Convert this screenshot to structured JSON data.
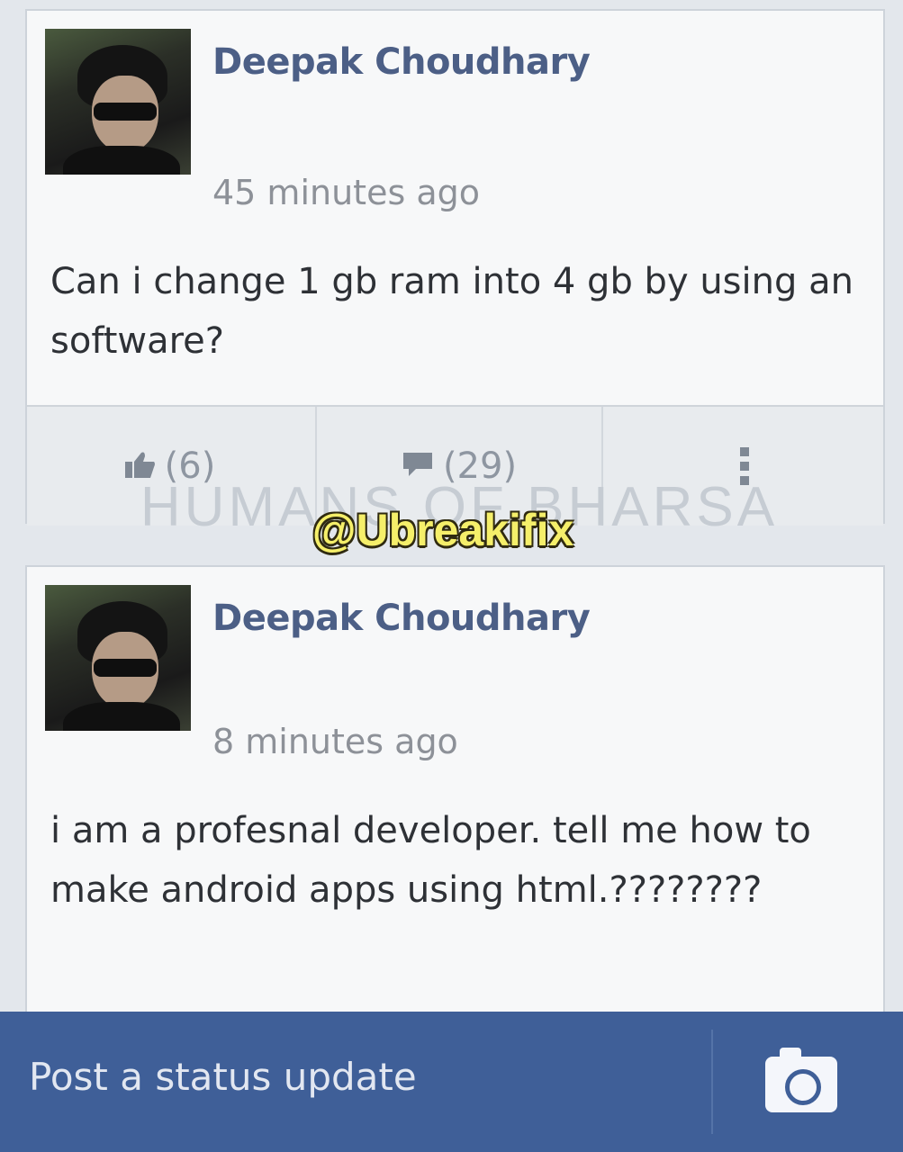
{
  "posts": [
    {
      "author": "Deepak Choudhary",
      "time": "45 minutes ago",
      "text": "Can i change 1 gb ram into 4 gb by using an software?",
      "likes": "(6)",
      "comments": "(29)"
    },
    {
      "author": "Deepak Choudhary",
      "time": "8 minutes ago",
      "text": "i am a profesnal developer. tell me how to make android apps using html.????????"
    }
  ],
  "watermark": "HUMANS OF BHARSA",
  "overlay_tag": "@Ubreakifix",
  "status_bar": {
    "placeholder": "Post a status update",
    "camera_icon": "camera-icon"
  },
  "colors": {
    "author_blue": "#4c5f86",
    "status_bar": "#3f5f98",
    "tag_yellow": "#f5ef6a"
  }
}
